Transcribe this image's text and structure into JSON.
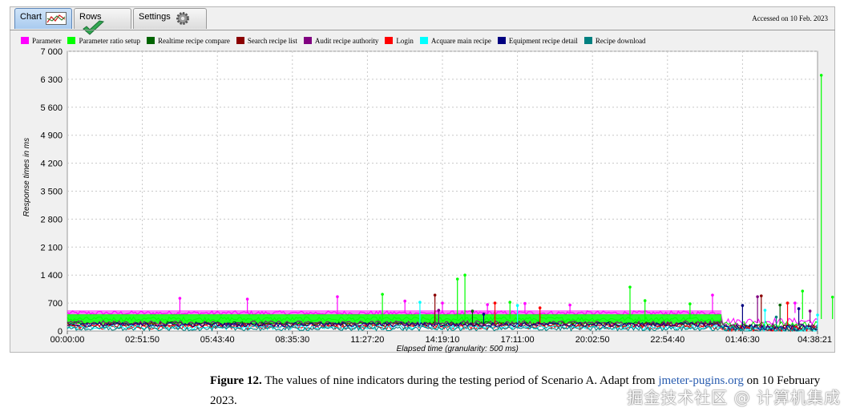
{
  "tabs": [
    {
      "label": "Chart",
      "icon": "chart-icon",
      "active": true
    },
    {
      "label": "Rows",
      "icon": "checkmark-icon",
      "active": false
    },
    {
      "label": "Settings",
      "icon": "gear-icon",
      "active": false
    }
  ],
  "accessed": "Accessed on 10 Feb. 2023",
  "chart_data": {
    "type": "line",
    "xlabel": "Elapsed time (granularity: 500 ms)",
    "ylabel": "Response times in ms",
    "y_ticks": [
      0,
      700,
      1400,
      2100,
      2800,
      3500,
      4200,
      4900,
      5600,
      6300,
      7000
    ],
    "y_tick_labels": [
      "0",
      "700",
      "1 400",
      "2 100",
      "2 800",
      "3 500",
      "4 200",
      "4 900",
      "5 600",
      "6 300",
      "7 000"
    ],
    "x_tick_labels": [
      "00:00:00",
      "02:51:50",
      "05:43:40",
      "08:35:30",
      "11:27:20",
      "14:19:10",
      "17:11:00",
      "20:02:50",
      "22:54:40",
      "01:46:30",
      "04:38:21"
    ],
    "ylim": [
      0,
      7000
    ],
    "grid": true,
    "legend_position": "top",
    "series": [
      {
        "name": "Parameter",
        "color": "#ff00ff",
        "level": 450,
        "spikes": [
          [
            1.5,
            820
          ],
          [
            2.4,
            800
          ],
          [
            3.6,
            860
          ],
          [
            4.5,
            750
          ],
          [
            5.0,
            700
          ],
          [
            5.6,
            660
          ],
          [
            6.1,
            690
          ],
          [
            6.7,
            650
          ],
          [
            8.6,
            900
          ],
          [
            9.7,
            700
          ],
          [
            10.8,
            640
          ],
          [
            12.3,
            620
          ]
        ]
      },
      {
        "name": "Parameter ratio setup",
        "color": "#00ff00",
        "level": 300,
        "spikes": [
          [
            4.2,
            920
          ],
          [
            5.2,
            1300
          ],
          [
            5.3,
            1400
          ],
          [
            5.9,
            720
          ],
          [
            7.5,
            1100
          ],
          [
            7.7,
            760
          ],
          [
            8.3,
            680
          ],
          [
            9.8,
            1000
          ],
          [
            10.05,
            6400
          ],
          [
            10.2,
            850
          ]
        ]
      },
      {
        "name": "Realtime recipe compare",
        "color": "#006400",
        "level": 180,
        "spikes": [
          [
            5.4,
            500
          ],
          [
            9.5,
            650
          ],
          [
            10.4,
            520
          ]
        ]
      },
      {
        "name": "Search recipe list",
        "color": "#8b0000",
        "level": 150,
        "spikes": [
          [
            4.9,
            900
          ],
          [
            9.25,
            880
          ],
          [
            10.3,
            700
          ]
        ]
      },
      {
        "name": "Audit recipe authority",
        "color": "#800080",
        "level": 200,
        "spikes": [
          [
            4.95,
            520
          ],
          [
            9.2,
            860
          ],
          [
            9.9,
            500
          ]
        ]
      },
      {
        "name": "Login",
        "color": "#ff0000",
        "level": 100,
        "spikes": [
          [
            5.7,
            700
          ],
          [
            6.3,
            580
          ],
          [
            9.6,
            700
          ],
          [
            10.3,
            560
          ]
        ]
      },
      {
        "name": "Acquare main recipe",
        "color": "#00ffff",
        "level": 90,
        "spikes": [
          [
            4.7,
            720
          ],
          [
            6.0,
            640
          ],
          [
            9.3,
            520
          ],
          [
            10.0,
            400
          ]
        ]
      },
      {
        "name": "Equipment recipe detail",
        "color": "#000080",
        "level": 160,
        "spikes": [
          [
            5.55,
            420
          ],
          [
            9.0,
            640
          ],
          [
            9.75,
            560
          ],
          [
            10.5,
            480
          ]
        ]
      },
      {
        "name": "Recipe download",
        "color": "#008080",
        "level": 60,
        "spikes": [
          [
            9.45,
            350
          ]
        ]
      }
    ]
  },
  "caption": {
    "label": "Figure 12.",
    "text": " The values of nine indicators during the testing period of Scenario A. Adapt from ",
    "link": "jmeter-pugins.org",
    "text_end": " on 10 February 2023."
  },
  "watermark": "掘金技术社区 @ 计算机集成"
}
